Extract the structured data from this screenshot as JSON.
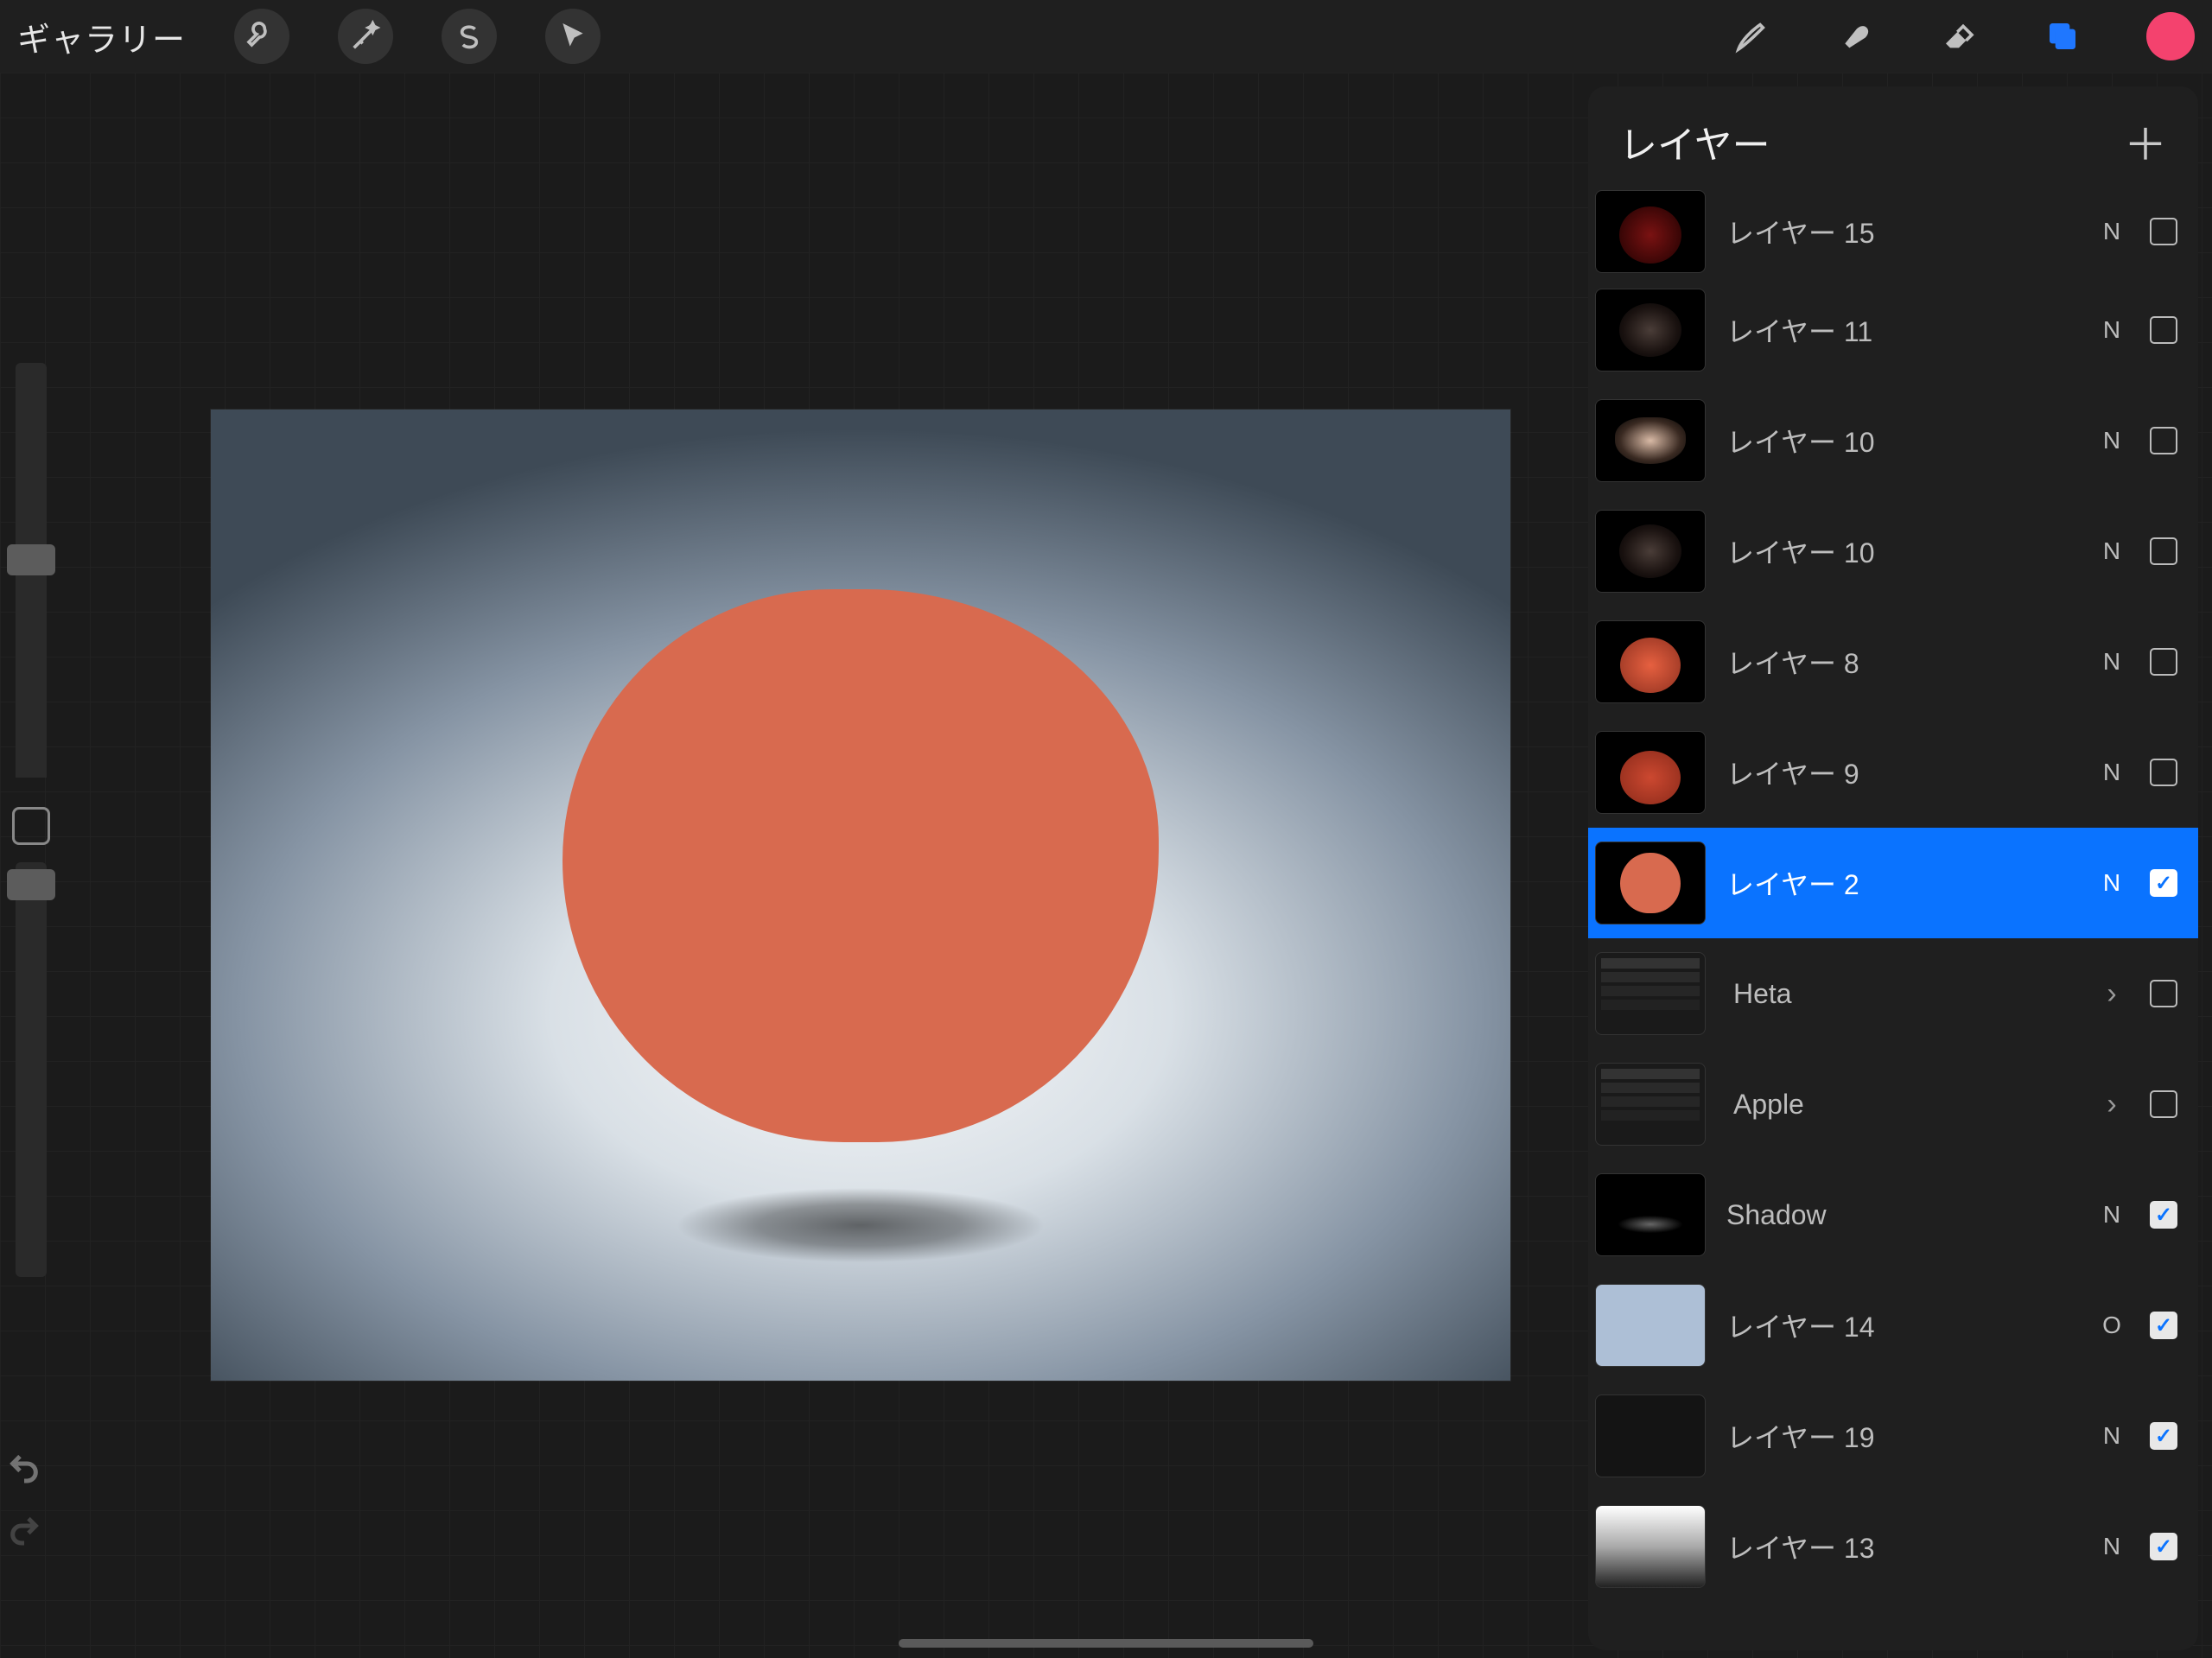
{
  "topbar": {
    "gallery_label": "ギャラリー",
    "color_swatch": "#f4426e"
  },
  "layers_panel": {
    "title": "レイヤー",
    "items": [
      {
        "label": "レイヤー 15",
        "blend": "N",
        "visible": false,
        "thumb": "dark-red",
        "type": "layer",
        "selected": false
      },
      {
        "label": "レイヤー 11",
        "blend": "N",
        "visible": false,
        "thumb": "shine",
        "type": "layer",
        "selected": false
      },
      {
        "label": "レイヤー 10",
        "blend": "N",
        "visible": false,
        "thumb": "stem",
        "type": "layer",
        "selected": false
      },
      {
        "label": "レイヤー 10",
        "blend": "N",
        "visible": false,
        "thumb": "shine",
        "type": "layer",
        "selected": false
      },
      {
        "label": "レイヤー 8",
        "blend": "N",
        "visible": false,
        "thumb": "solid",
        "type": "layer",
        "selected": false
      },
      {
        "label": "レイヤー 9",
        "blend": "N",
        "visible": false,
        "thumb": "body",
        "type": "layer",
        "selected": false
      },
      {
        "label": "レイヤー 2",
        "blend": "N",
        "visible": true,
        "thumb": "apple",
        "type": "layer",
        "selected": true
      },
      {
        "label": "Heta",
        "blend": "",
        "visible": false,
        "thumb": "grp",
        "type": "group",
        "selected": false
      },
      {
        "label": "Apple",
        "blend": "",
        "visible": false,
        "thumb": "grp",
        "type": "group",
        "selected": false
      },
      {
        "label": "Shadow",
        "blend": "N",
        "visible": true,
        "thumb": "shadowprev",
        "type": "layer",
        "selected": false
      },
      {
        "label": "レイヤー 14",
        "blend": "O",
        "visible": true,
        "thumb": "pale-blue",
        "type": "layer",
        "selected": false
      },
      {
        "label": "レイヤー 19",
        "blend": "N",
        "visible": true,
        "thumb": "blank",
        "type": "layer",
        "selected": false
      },
      {
        "label": "レイヤー 13",
        "blend": "N",
        "visible": true,
        "thumb": "gradient",
        "type": "layer",
        "selected": false
      }
    ]
  }
}
